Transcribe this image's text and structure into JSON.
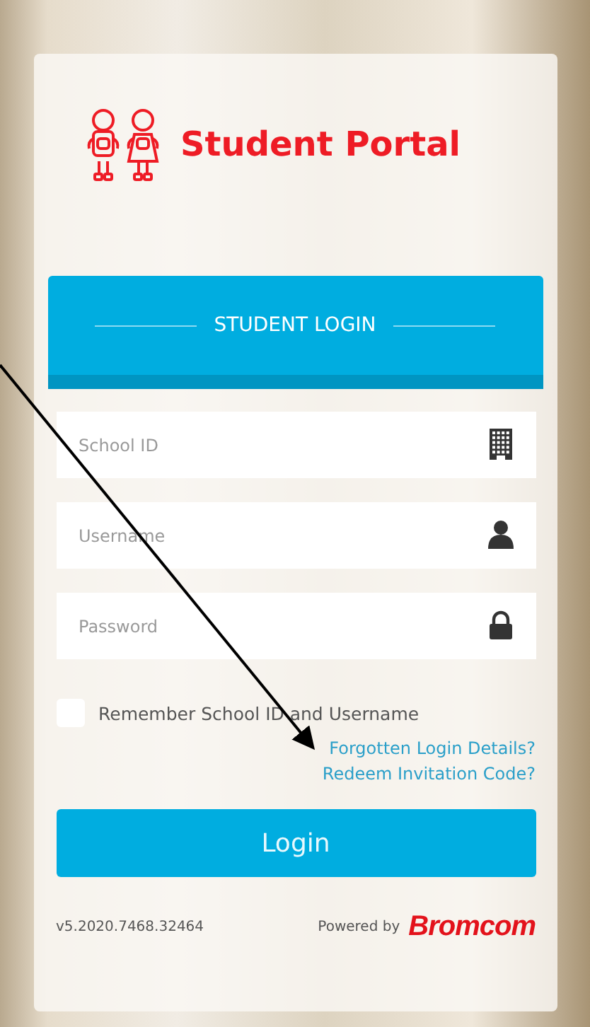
{
  "brand": {
    "title": "Student Portal"
  },
  "header": {
    "title": "STUDENT LOGIN"
  },
  "fields": [
    {
      "placeholder": "School ID",
      "kind": "building"
    },
    {
      "placeholder": "Username",
      "kind": "user"
    },
    {
      "placeholder": "Password",
      "kind": "lock"
    }
  ],
  "remember": {
    "label": "Remember School ID and Username",
    "checked": false
  },
  "links": [
    "Forgotten Login Details?",
    "Redeem Invitation Code?"
  ],
  "login_button": "Login",
  "footer": {
    "version": "v5.2020.7468.32464",
    "powered_by": "Powered by",
    "logo": "Bromcom"
  }
}
